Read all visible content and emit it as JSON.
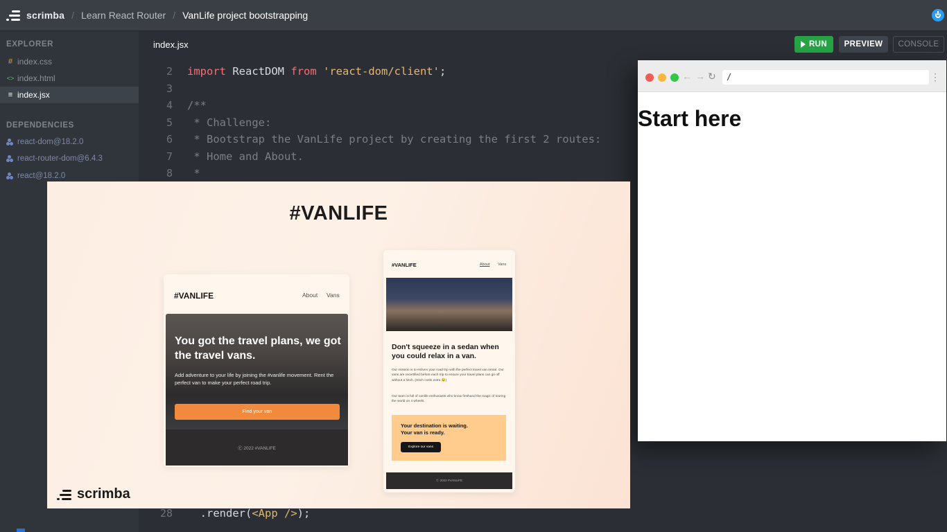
{
  "app": {
    "brand": "scrimba",
    "breadcrumbs": [
      "Learn React Router",
      "VanLife project bootstrapping"
    ]
  },
  "sidebar": {
    "explorer_heading": "EXPLORER",
    "files": [
      {
        "icon": "css-hash-icon",
        "glyph": "#",
        "name": "index.css",
        "color": "#e0a64a"
      },
      {
        "icon": "html-brackets-icon",
        "glyph": "<>",
        "name": "index.html",
        "color": "#6fb37a"
      },
      {
        "icon": "jsx-file-icon",
        "glyph": "≡",
        "name": "index.jsx",
        "color": "#ffffff"
      }
    ],
    "dependencies_heading": "DEPENDENCIES",
    "dependencies": [
      "react-dom@18.2.0",
      "react-router-dom@6.4.3",
      "react@18.2.0"
    ]
  },
  "editor": {
    "tab_name": "index.jsx",
    "run_label": "RUN",
    "preview_label": "PREVIEW",
    "console_label": "CONSOLE",
    "lines": [
      {
        "n": "2",
        "parts": [
          [
            "kw",
            "import"
          ],
          [
            "plain",
            " ReactDOM "
          ],
          [
            "kw",
            "from"
          ],
          [
            "plain",
            " "
          ],
          [
            "str",
            "'react-dom/client'"
          ],
          [
            "plain",
            ";"
          ]
        ]
      },
      {
        "n": "3",
        "parts": []
      },
      {
        "n": "4",
        "parts": [
          [
            "comment",
            "/**"
          ]
        ]
      },
      {
        "n": "5",
        "parts": [
          [
            "comment",
            " * Challenge:"
          ]
        ]
      },
      {
        "n": "6",
        "parts": [
          [
            "comment",
            " * Bootstrap the VanLife project by creating the first 2 routes:"
          ]
        ]
      },
      {
        "n": "7",
        "parts": [
          [
            "comment",
            " * Home and About."
          ]
        ]
      },
      {
        "n": "8",
        "parts": [
          [
            "comment",
            " *"
          ]
        ]
      }
    ],
    "last_line": {
      "n": "28",
      "parts": [
        [
          "plain",
          "  .render("
        ],
        [
          "jsx",
          "<App />"
        ],
        [
          "plain",
          ");"
        ]
      ]
    }
  },
  "preview": {
    "url": "/",
    "heading": "Start here"
  },
  "slide": {
    "title": "#VANLIFE",
    "logo_text": "scrimba",
    "home_mock": {
      "brand": "#VANLIFE",
      "nav": [
        "About",
        "Vans"
      ],
      "headline": "You got the travel plans, we got the travel vans.",
      "body": "Add adventure to your life by joining the #vanlife movement. Rent the perfect van to make your perfect road trip.",
      "cta": "Find your van",
      "footer": "Ⓒ 2022 #VANLIFE"
    },
    "about_mock": {
      "brand": "#VANLIFE",
      "nav": [
        "About",
        "Vans"
      ],
      "headline": "Don't squeeze in a sedan when you could relax in a van.",
      "para1": "Our mission is to enliven your road trip with the perfect travel van rental. Our vans are recertified before each trip to ensure your travel plans can go off without a hitch. (Hitch costs extra 😉)",
      "para2": "Our team is full of vanlife enthusiasts who know firsthand the magic of touring the world on 4 wheels.",
      "box_heading_1": "Your destination is waiting.",
      "box_heading_2": "Your van is ready.",
      "box_button": "Explore our vans",
      "footer": "Ⓒ 2022 #VANLIFE"
    }
  },
  "colors": {
    "run_green": "#27a245",
    "accent_blue": "#2a9df4",
    "cta_orange": "#f28a3d"
  }
}
